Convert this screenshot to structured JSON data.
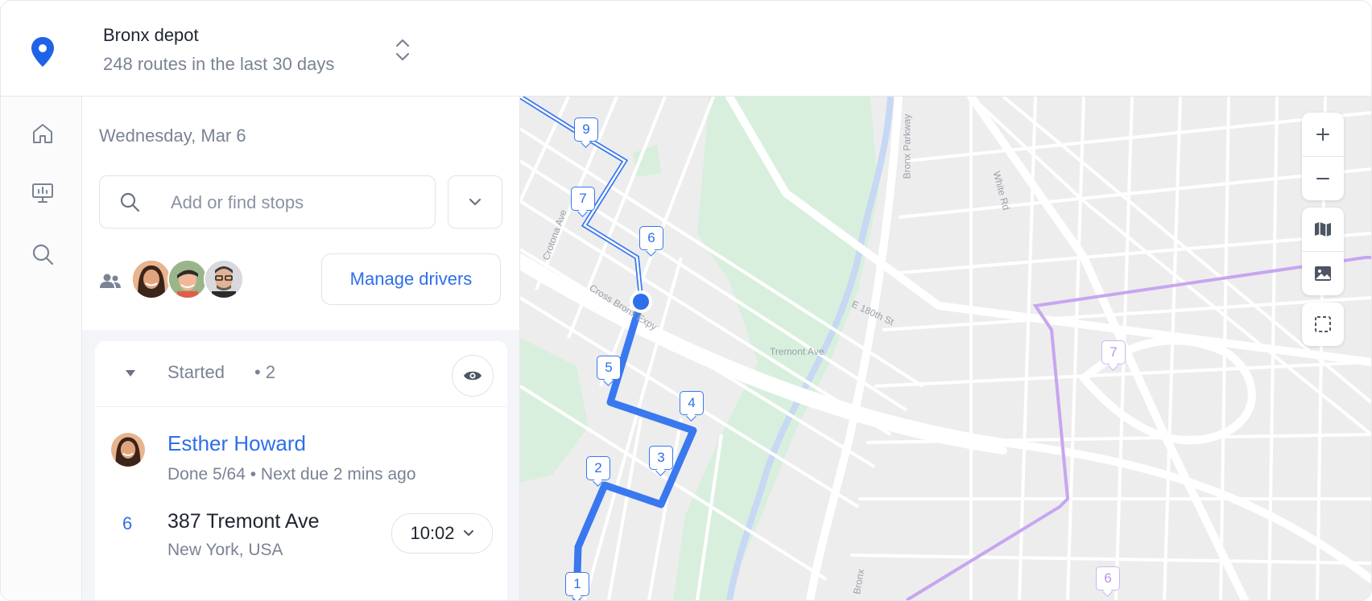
{
  "header": {
    "depot_title": "Bronx depot",
    "depot_subtitle": "248 routes in the last 30 days"
  },
  "rail": {
    "items": [
      "home-icon",
      "presentation-icon",
      "search-icon"
    ]
  },
  "panel": {
    "date": "Wednesday, Mar 6",
    "search_placeholder": "Add or find stops",
    "manage_drivers_label": "Manage drivers",
    "section": {
      "label": "Started",
      "count": "• 2"
    },
    "driver": {
      "name": "Esther Howard",
      "status": "Done 5/64  • Next due 2 mins ago"
    },
    "stop": {
      "number": "6",
      "address": "387 Tremont Ave",
      "city": "New York, USA",
      "time": "10:02"
    }
  },
  "map": {
    "streets": {
      "crotona": "Crotona Ave",
      "cross_bronx": "Cross Bronx Expy",
      "e180": "E 180th St",
      "tremont": "Tremont Ave",
      "bronx_pkwy": "Bronx Parkway",
      "white_rd": "White Rd",
      "bronx_river": "Bronx"
    },
    "blue_markers": [
      "9",
      "7",
      "6",
      "5",
      "4",
      "3",
      "2",
      "1"
    ],
    "purple_markers": [
      "7",
      "6"
    ]
  },
  "colors": {
    "accent": "#2d6fea",
    "route_purple": "#c7a6f0",
    "park": "#d8efdd"
  }
}
